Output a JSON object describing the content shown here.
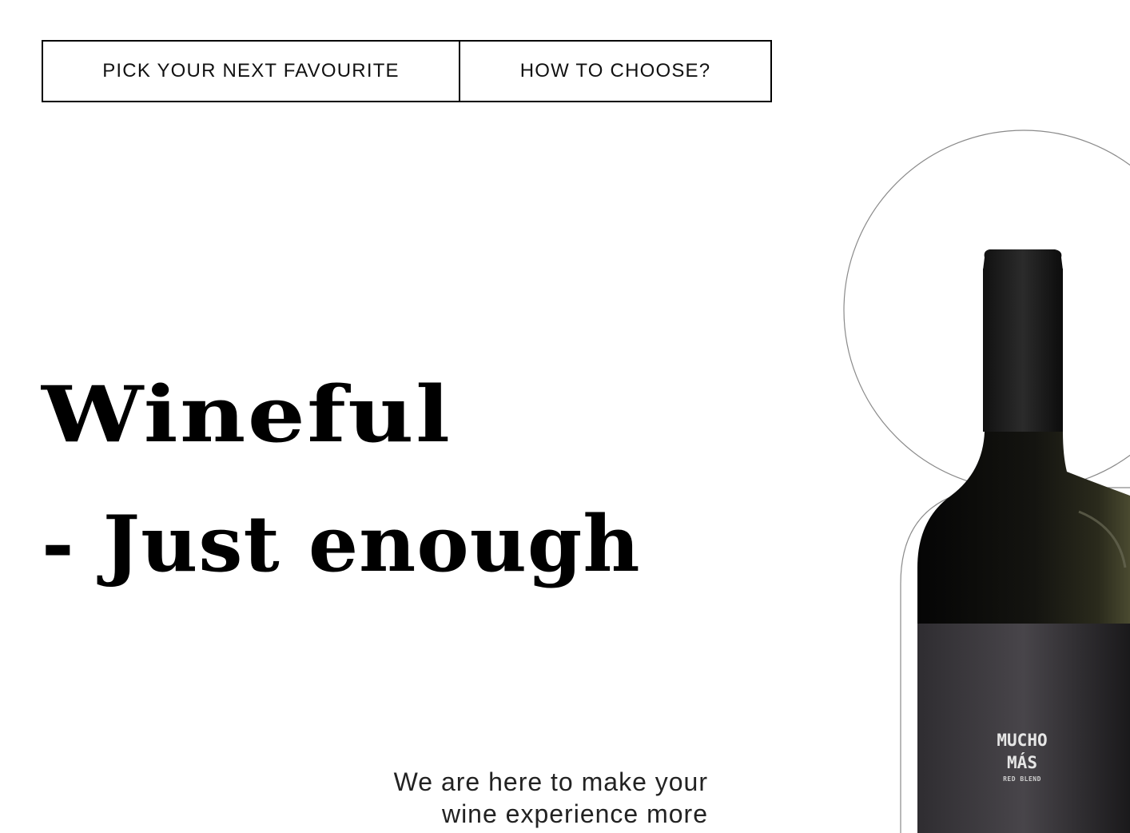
{
  "nav": {
    "pick_label": "PICK YOUR NEXT FAVOURITE",
    "choose_label": "HOW TO CHOOSE?"
  },
  "hero": {
    "line1": "Wineful",
    "line2": "- Just enough"
  },
  "tagline": {
    "line1": "We are here to make your",
    "line2": "wine experience more"
  },
  "product": {
    "label_brand_line1": "MUCHO",
    "label_brand_line2": "MÁS",
    "label_sub": "RED BLEND"
  },
  "colors": {
    "bottle_glass": "#0f0f0d",
    "bottle_label": "#3c3a3d",
    "outline": "#8a8a8a"
  }
}
